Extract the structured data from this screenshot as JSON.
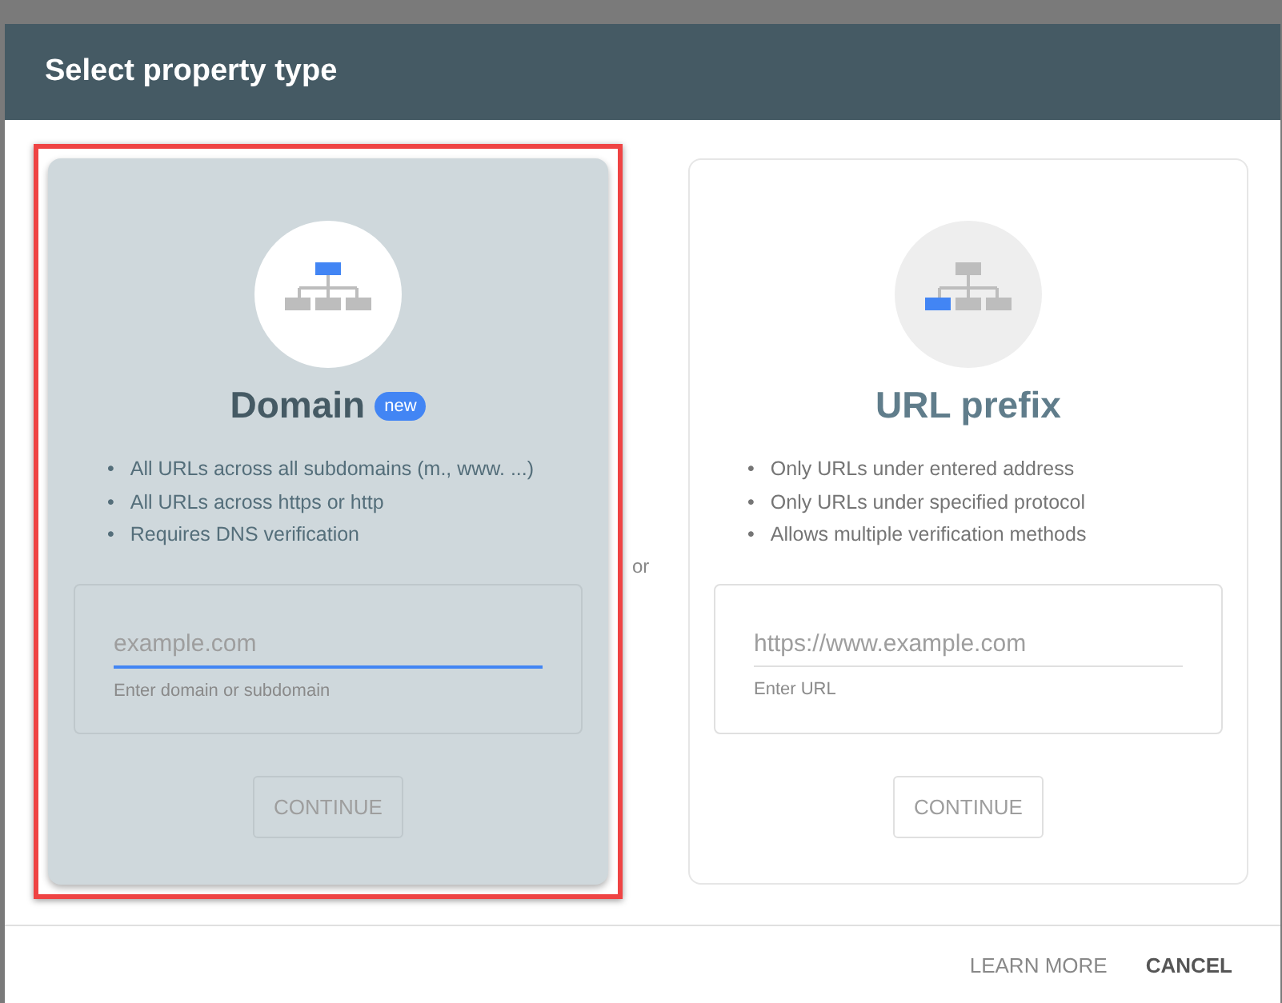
{
  "dialog": {
    "title": "Select property type",
    "options": [
      {
        "kind": "domain",
        "title": "Domain",
        "badge": "new",
        "selected": true,
        "bullets": [
          "All URLs across all subdomains (m., www. ...)",
          "All URLs across https or http",
          "Requires DNS verification"
        ],
        "field": {
          "placeholder": "example.com",
          "hint": "Enter domain or subdomain",
          "focused": true
        },
        "button": "CONTINUE"
      },
      {
        "kind": "prefix",
        "title": "URL prefix",
        "selected": false,
        "bullets": [
          "Only URLs under entered address",
          "Only URLs under specified protocol",
          "Allows multiple verification methods"
        ],
        "field": {
          "placeholder": "https://www.example.com",
          "hint": "Enter URL",
          "focused": false
        },
        "button": "CONTINUE"
      }
    ],
    "separator": "or",
    "bullet_marker": "•",
    "actions": [
      "LEARN MORE",
      "CANCEL"
    ]
  }
}
